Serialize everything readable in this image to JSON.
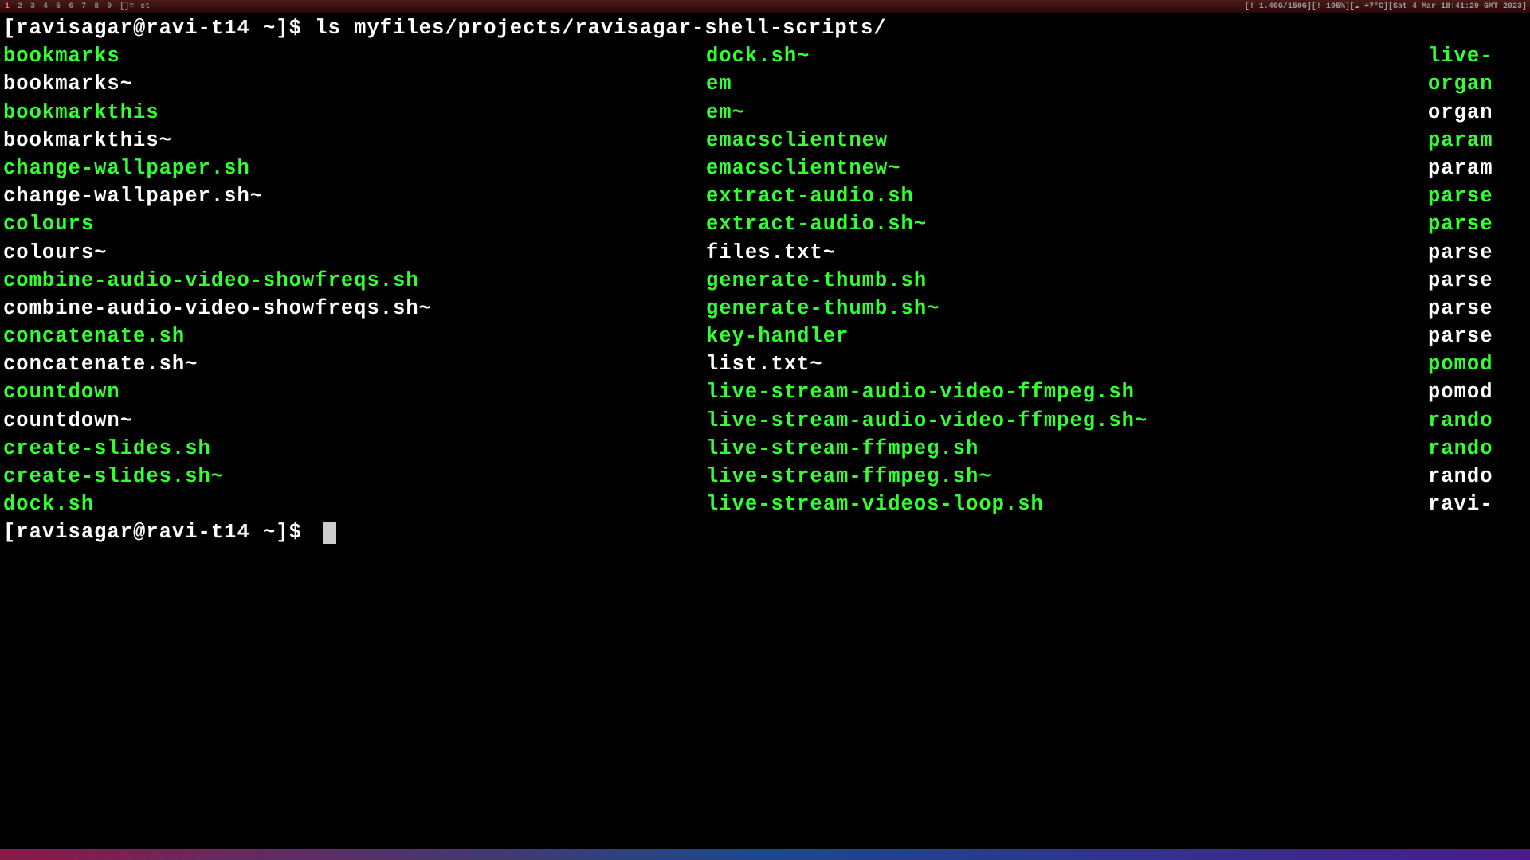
{
  "topbar": {
    "workspaces": [
      "1",
      "2",
      "3",
      "4",
      "5",
      "6",
      "7",
      "8",
      "9"
    ],
    "active_ws": 0,
    "title_marker": "[]=",
    "app": "st",
    "status": "[! 1.40G/150G][! 105%][☁ +7°C][Sat  4 Mar 18:41:29 GMT 2023]"
  },
  "prompt1": "[ravisagar@ravi-t14 ~]$ ",
  "command1": "ls myfiles/projects/ravisagar-shell-scripts/",
  "prompt2": "[ravisagar@ravi-t14 ~]$ ",
  "files": {
    "col1": [
      {
        "name": "bookmarks",
        "type": "exec"
      },
      {
        "name": "bookmarks~",
        "type": "regular"
      },
      {
        "name": "bookmarkthis",
        "type": "exec"
      },
      {
        "name": "bookmarkthis~",
        "type": "regular"
      },
      {
        "name": "change-wallpaper.sh",
        "type": "exec"
      },
      {
        "name": "change-wallpaper.sh~",
        "type": "regular"
      },
      {
        "name": "colours",
        "type": "exec"
      },
      {
        "name": "colours~",
        "type": "regular"
      },
      {
        "name": "combine-audio-video-showfreqs.sh",
        "type": "exec"
      },
      {
        "name": "combine-audio-video-showfreqs.sh~",
        "type": "regular"
      },
      {
        "name": "concatenate.sh",
        "type": "exec"
      },
      {
        "name": "concatenate.sh~",
        "type": "regular"
      },
      {
        "name": "countdown",
        "type": "exec"
      },
      {
        "name": "countdown~",
        "type": "regular"
      },
      {
        "name": "create-slides.sh",
        "type": "exec"
      },
      {
        "name": "create-slides.sh~",
        "type": "exec"
      },
      {
        "name": "dock.sh",
        "type": "exec"
      }
    ],
    "col2": [
      {
        "name": "dock.sh~",
        "type": "exec"
      },
      {
        "name": "em",
        "type": "exec"
      },
      {
        "name": "em~",
        "type": "exec"
      },
      {
        "name": "emacsclientnew",
        "type": "exec"
      },
      {
        "name": "emacsclientnew~",
        "type": "exec"
      },
      {
        "name": "extract-audio.sh",
        "type": "exec"
      },
      {
        "name": "extract-audio.sh~",
        "type": "exec"
      },
      {
        "name": "files.txt~",
        "type": "regular"
      },
      {
        "name": "generate-thumb.sh",
        "type": "exec"
      },
      {
        "name": "generate-thumb.sh~",
        "type": "exec"
      },
      {
        "name": "key-handler",
        "type": "exec"
      },
      {
        "name": "list.txt~",
        "type": "regular"
      },
      {
        "name": "live-stream-audio-video-ffmpeg.sh",
        "type": "exec"
      },
      {
        "name": "live-stream-audio-video-ffmpeg.sh~",
        "type": "exec"
      },
      {
        "name": "live-stream-ffmpeg.sh",
        "type": "exec"
      },
      {
        "name": "live-stream-ffmpeg.sh~",
        "type": "exec"
      },
      {
        "name": "live-stream-videos-loop.sh",
        "type": "exec"
      }
    ],
    "col3": [
      {
        "name": "live-",
        "type": "exec"
      },
      {
        "name": "organ",
        "type": "exec"
      },
      {
        "name": "organ",
        "type": "regular"
      },
      {
        "name": "param",
        "type": "exec"
      },
      {
        "name": "param",
        "type": "regular"
      },
      {
        "name": "parse",
        "type": "exec"
      },
      {
        "name": "parse",
        "type": "exec"
      },
      {
        "name": "parse",
        "type": "regular"
      },
      {
        "name": "parse",
        "type": "regular"
      },
      {
        "name": "parse",
        "type": "regular"
      },
      {
        "name": "parse",
        "type": "regular"
      },
      {
        "name": "pomod",
        "type": "exec"
      },
      {
        "name": "pomod",
        "type": "regular"
      },
      {
        "name": "rando",
        "type": "exec"
      },
      {
        "name": "rando",
        "type": "exec"
      },
      {
        "name": "rando",
        "type": "regular"
      },
      {
        "name": "ravi-",
        "type": "regular"
      }
    ]
  }
}
